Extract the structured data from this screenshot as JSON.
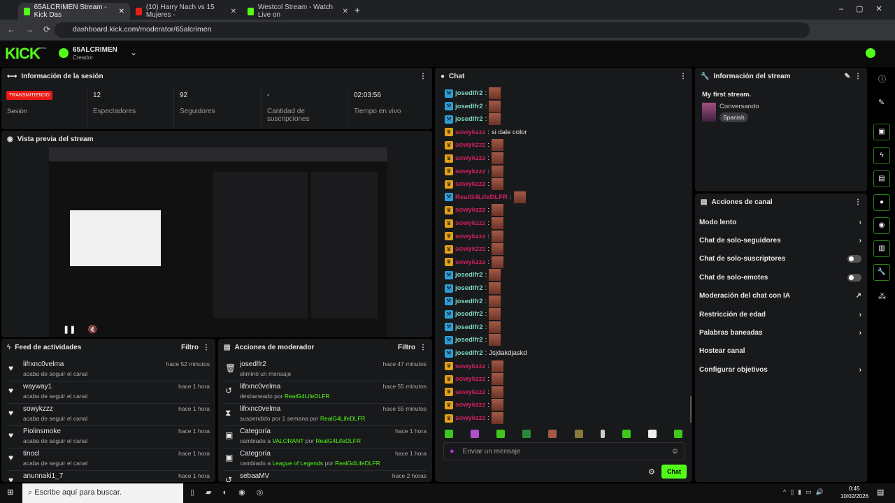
{
  "browser": {
    "tabs": [
      {
        "title": "65ALCRIMEN Stream - Kick Das",
        "active": true
      },
      {
        "title": "(10) Harry Nach vs 15 Mujeres -"
      },
      {
        "title": "Westcol Stream - Watch Live on"
      }
    ],
    "url": "dashboard.kick.com/moderator/65alcrimen"
  },
  "header": {
    "logo": "KICK",
    "logo_badge": "BETA",
    "channel": "65ALCRIMEN",
    "role": "Creador"
  },
  "session": {
    "title": "Información de la sesión",
    "live_badge": "TRANSMITIENDO",
    "live_label": "Sesión",
    "stats": [
      {
        "value": "12",
        "label": "Espectadores"
      },
      {
        "value": "92",
        "label": "Seguidores"
      },
      {
        "value": "-",
        "label": "Cantidad de suscripciones"
      },
      {
        "value": "02:03:56",
        "label": "Tiempo en vivo"
      }
    ]
  },
  "preview": {
    "title": "Vista previa del stream"
  },
  "feed": {
    "title": "Feed de actividades",
    "filter": "Filtro",
    "items": [
      {
        "name": "lifrxnc0velma",
        "desc": "acaba de seguir el canal",
        "time": "hace 52 minutos"
      },
      {
        "name": "wayway1",
        "desc": "acaba de seguir el canal",
        "time": "hace 1 hora"
      },
      {
        "name": "sowykzzz",
        "desc": "acaba de seguir el canal",
        "time": "hace 1 hora"
      },
      {
        "name": "Piolinsmoke",
        "desc": "acaba de seguir el canal",
        "time": "hace 1 hora"
      },
      {
        "name": "tinocl",
        "desc": "acaba de seguir el canal",
        "time": "hace 1 hora"
      },
      {
        "name": "anunnaki1_7",
        "desc": "",
        "time": "hace 1 hora"
      }
    ]
  },
  "modactions": {
    "title": "Acciones de moderador",
    "filter": "Filtro",
    "items": [
      {
        "icon": "trash",
        "name": "josedlfr2",
        "desc": "eliminó un mensaje",
        "time": "hace 47 minutos"
      },
      {
        "icon": "unban",
        "name": "lifrxnc0velma",
        "desc": "desbaneado por ",
        "by": "RealG4LifeDLFR",
        "time": "hace 55 minutos"
      },
      {
        "icon": "hourglass",
        "name": "lifrxnc0velma",
        "desc": "suspendido por 1 semana por ",
        "by": "RealG4LifeDLFR",
        "time": "hace 55 minutos"
      },
      {
        "icon": "category",
        "name": "Categoría",
        "desc": "cambiado a ",
        "cat": "VALORANT",
        "mid": " por ",
        "by": "RealG4LifeDLFR",
        "time": "hace 1 hora"
      },
      {
        "icon": "category",
        "name": "Categoría",
        "desc": "cambiado a ",
        "cat": "League of Legends",
        "mid": " por ",
        "by": "RealG4LifeDLFR",
        "time": "hace 1 hora"
      },
      {
        "icon": "unban",
        "name": "sebaaMV",
        "desc": "",
        "time": "hace 2 horas"
      }
    ]
  },
  "chat": {
    "title": "Chat",
    "placeholder": "Enviar un mensaje",
    "send": "Chat",
    "messages": [
      {
        "user": "josedlfr2",
        "color": "#7fd6c2",
        "badge": "mod",
        "text": ""
      },
      {
        "user": "josedlfr2",
        "color": "#7fd6c2",
        "badge": "mod",
        "text": ""
      },
      {
        "user": "josedlfr2",
        "color": "#7fd6c2",
        "badge": "mod",
        "text": ""
      },
      {
        "user": "sowykzzz",
        "color": "#d0215f",
        "badge": "crown",
        "text": "si dale color"
      },
      {
        "user": "sowykzzz",
        "color": "#d0215f",
        "badge": "crown",
        "text": ""
      },
      {
        "user": "sowykzzz",
        "color": "#d0215f",
        "badge": "crown",
        "text": ""
      },
      {
        "user": "sowykzzz",
        "color": "#d0215f",
        "badge": "crown",
        "text": ""
      },
      {
        "user": "sowykzzz",
        "color": "#d0215f",
        "badge": "crown",
        "text": ""
      },
      {
        "user": "RealG4LifeDLFR",
        "color": "#d0215f",
        "badge": "mod",
        "text": ""
      },
      {
        "user": "sowykzzz",
        "color": "#d0215f",
        "badge": "crown",
        "text": ""
      },
      {
        "user": "sowykzzz",
        "color": "#d0215f",
        "badge": "crown",
        "text": ""
      },
      {
        "user": "sowykzzz",
        "color": "#d0215f",
        "badge": "crown",
        "text": ""
      },
      {
        "user": "sowykzzz",
        "color": "#d0215f",
        "badge": "crown",
        "text": ""
      },
      {
        "user": "sowykzzz",
        "color": "#d0215f",
        "badge": "crown",
        "text": ""
      },
      {
        "user": "josedlfr2",
        "color": "#7fd6c2",
        "badge": "mod",
        "text": ""
      },
      {
        "user": "josedlfr2",
        "color": "#7fd6c2",
        "badge": "mod",
        "text": ""
      },
      {
        "user": "josedlfr2",
        "color": "#7fd6c2",
        "badge": "mod",
        "text": ""
      },
      {
        "user": "josedlfr2",
        "color": "#7fd6c2",
        "badge": "mod",
        "text": ""
      },
      {
        "user": "josedlfr2",
        "color": "#7fd6c2",
        "badge": "mod",
        "text": ""
      },
      {
        "user": "josedlfr2",
        "color": "#7fd6c2",
        "badge": "mod",
        "text": ""
      },
      {
        "user": "josedlfr2",
        "color": "#7fd6c2",
        "badge": "mod",
        "text": "Jsjdakdjaskd"
      },
      {
        "user": "sowykzzz",
        "color": "#d0215f",
        "badge": "crown",
        "text": ""
      },
      {
        "user": "sowykzzz",
        "color": "#d0215f",
        "badge": "crown",
        "text": ""
      },
      {
        "user": "sowykzzz",
        "color": "#d0215f",
        "badge": "crown",
        "text": ""
      },
      {
        "user": "sowykzzz",
        "color": "#d0215f",
        "badge": "crown",
        "text": ""
      },
      {
        "user": "sowykzzz",
        "color": "#d0215f",
        "badge": "crown",
        "text": ""
      }
    ]
  },
  "streaminfo": {
    "title": "Información del stream",
    "stream_title": "My first stream.",
    "category": "Conversando",
    "language": "Spanish"
  },
  "channel_actions": {
    "title": "Acciones de canal",
    "items": [
      {
        "label": "Modo lento",
        "control": "chevron"
      },
      {
        "label": "Chat de solo-seguidores",
        "control": "chevron"
      },
      {
        "label": "Chat de solo-suscriptores",
        "control": "toggle",
        "on": false
      },
      {
        "label": "Chat de solo-emotes",
        "control": "toggle",
        "on": false
      },
      {
        "label": "Moderación del chat con IA",
        "control": "external"
      },
      {
        "label": "Restricción de edad",
        "control": "chevron"
      },
      {
        "label": "Palabras baneadas",
        "control": "chevron"
      },
      {
        "label": "Hostear canal",
        "control": "none"
      },
      {
        "label": "Configurar objetivos",
        "control": "chevron"
      }
    ]
  },
  "taskbar": {
    "search": "Escribe aquí para buscar.",
    "time": "0:45",
    "date": "10/02/2026"
  },
  "colors": {
    "accent": "#53fc18",
    "live": "#e91916"
  }
}
